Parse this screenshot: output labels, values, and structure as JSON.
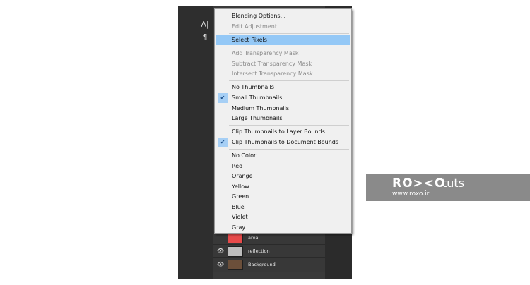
{
  "tools": {
    "character_glyph": "A|",
    "paragraph_glyph": "¶"
  },
  "menu": {
    "items": [
      {
        "label": "Blending Options...",
        "state": "enabled"
      },
      {
        "label": "Edit Adjustment...",
        "state": "disabled"
      },
      {
        "label": "Select Pixels",
        "state": "highlighted"
      },
      {
        "label": "Add Transparency Mask",
        "state": "disabled"
      },
      {
        "label": "Subtract Transparency Mask",
        "state": "disabled"
      },
      {
        "label": "Intersect Transparency Mask",
        "state": "disabled"
      },
      {
        "label": "No Thumbnails",
        "state": "enabled"
      },
      {
        "label": "Small Thumbnails",
        "state": "checked"
      },
      {
        "label": "Medium Thumbnails",
        "state": "enabled"
      },
      {
        "label": "Large Thumbnails",
        "state": "enabled"
      },
      {
        "label": "Clip Thumbnails to Layer Bounds",
        "state": "enabled"
      },
      {
        "label": "Clip Thumbnails to Document Bounds",
        "state": "checked"
      },
      {
        "label": "No Color",
        "state": "enabled"
      },
      {
        "label": "Red",
        "state": "enabled"
      },
      {
        "label": "Orange",
        "state": "enabled"
      },
      {
        "label": "Yellow",
        "state": "enabled"
      },
      {
        "label": "Green",
        "state": "enabled"
      },
      {
        "label": "Blue",
        "state": "enabled"
      },
      {
        "label": "Violet",
        "state": "enabled"
      },
      {
        "label": "Gray",
        "state": "enabled"
      }
    ],
    "checkmark": "✔"
  },
  "layers": {
    "eye_glyph": "👁",
    "rows": [
      {
        "name": "area",
        "visible": false
      },
      {
        "name": "reflection",
        "visible": true
      },
      {
        "name": "Background",
        "visible": true
      }
    ]
  },
  "branding": {
    "logo": "RO><O",
    "suffix": "tuts",
    "url": "www.roxo.ir"
  },
  "colors": {
    "menu_highlight": "#94c8f6",
    "check_bg": "#a6cff5",
    "brand_bg": "#8a8a8a"
  }
}
